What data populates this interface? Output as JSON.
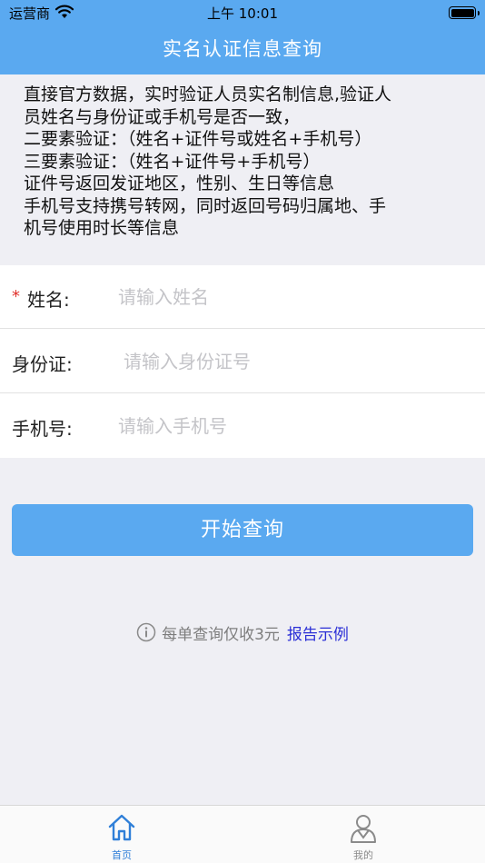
{
  "status_bar": {
    "carrier": "运营商",
    "time": "上午 10:01"
  },
  "header": {
    "title": "实名认证信息查询"
  },
  "intro": {
    "lines": [
      "直接官方数据，实时验证人员实名制信息,验证人",
      "员姓名与身份证或手机号是否一致，",
      "二要素验证：（姓名+证件号或姓名+手机号）",
      "三要素验证：（姓名+证件号+手机号）",
      "证件号返回发证地区，性别、生日等信息",
      "手机号支持携号转网，同时返回号码归属地、手",
      "机号使用时长等信息"
    ]
  },
  "form": {
    "name": {
      "required_mark": "*",
      "label": "姓名:",
      "placeholder": "请输入姓名",
      "value": ""
    },
    "id_card": {
      "label": "身份证:",
      "placeholder": "请输入身份证号",
      "value": ""
    },
    "phone": {
      "label": "手机号:",
      "placeholder": "请输入手机号",
      "value": ""
    }
  },
  "actions": {
    "submit_label": "开始查询"
  },
  "pricing": {
    "note": "每单查询仅收3元",
    "report_link": "报告示例"
  },
  "tab_bar": {
    "tabs": [
      {
        "label": "首页",
        "icon": "home-icon",
        "active": true
      },
      {
        "label": "我的",
        "icon": "profile-icon",
        "active": false
      }
    ]
  },
  "colors": {
    "primary": "#5aa9f0",
    "link": "#2b2fd6",
    "required": "#e0312b",
    "active_tab": "#2f7fd8"
  }
}
